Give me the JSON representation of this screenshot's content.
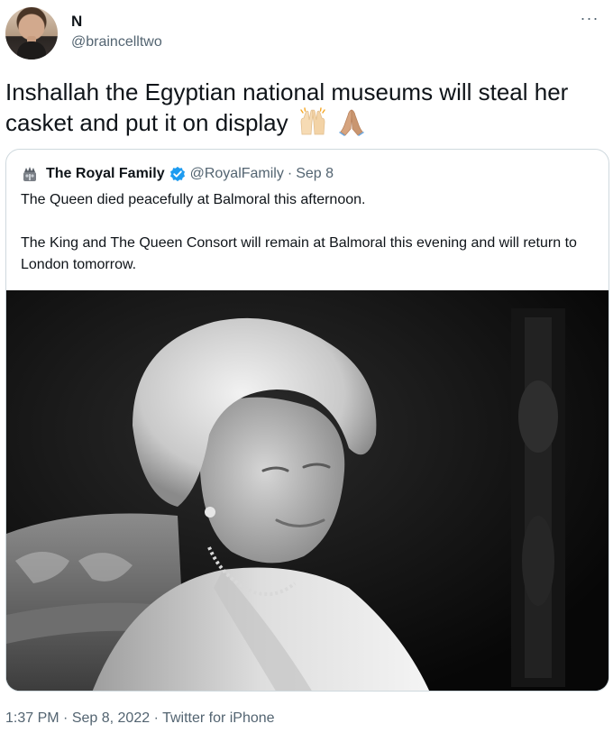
{
  "author": {
    "display_name": "N",
    "handle": "@braincelltwo",
    "avatar_icon": "user-avatar"
  },
  "menu": {
    "more_icon": "more-horizontal-icon",
    "more_glyph": "···"
  },
  "tweet": {
    "text": "Inshallah the Egyptian national museums will steal her casket and put it on display",
    "emojis": [
      "raising-hands-icon",
      "folded-hands-icon"
    ]
  },
  "quote": {
    "display_name": "The Royal Family",
    "handle": "@RoyalFamily",
    "separator": "·",
    "date": "Sep 8",
    "paragraph1": "The Queen died peacefully at Balmoral this afternoon.",
    "paragraph2": "The King and The Queen Consort will remain at Balmoral this evening and will return to London tomorrow.",
    "image_icon": "portrait-photo",
    "verified_color": "#1d9bf0"
  },
  "meta": {
    "time": "1:37 PM",
    "sep1": "·",
    "date": "Sep 8, 2022",
    "sep2": "·",
    "source": "Twitter for iPhone"
  },
  "colors": {
    "text": "#0f1419",
    "secondary": "#536471",
    "border": "#cfd9de",
    "accent": "#1d9bf0"
  }
}
